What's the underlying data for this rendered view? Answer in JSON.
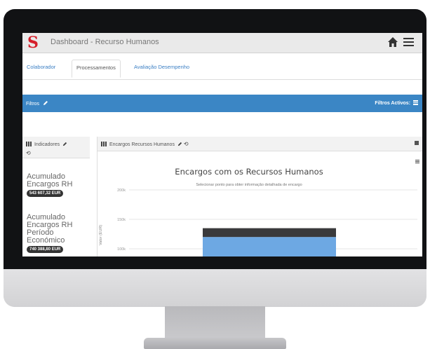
{
  "app": {
    "logo": "S",
    "title": "Dashboard - Recurso Humanos"
  },
  "tabs": [
    {
      "label": "Colaborador"
    },
    {
      "label": "Processamentos",
      "active": true
    },
    {
      "label": "Avaliação Desempenho"
    }
  ],
  "filters": {
    "label": "Filtros",
    "active_label": "Filtros Activos:"
  },
  "indicators": {
    "title": "Indicadores",
    "items": [
      {
        "label": "Acumulado Encargos RH",
        "value": "543 607,32 EUR"
      },
      {
        "label": "Acumulado Encargos RH Período Económico",
        "value": "740 388,80 EUR"
      }
    ]
  },
  "panel": {
    "title": "Encargos Recursos Humanos"
  },
  "chart_data": {
    "type": "bar",
    "title": "Encargos com os Recursos Humanos",
    "subtitle": "Selecionar ponto para obter informação detalhada de encargo",
    "ylabel": "Valor (EUR)",
    "y_ticks": [
      "200k",
      "150k",
      "100k"
    ],
    "ylim": [
      0,
      200000
    ],
    "series": [
      {
        "color": "#f0f0f0",
        "values": [
          135000
        ]
      },
      {
        "color": "#3a3a3c",
        "values": [
          15000
        ]
      },
      {
        "color": "#6da8e3",
        "values": [
          120000
        ]
      }
    ]
  },
  "colors": {
    "accent": "#3b86c5",
    "logo": "#d61f2b",
    "link": "#3b7fc4"
  },
  "icons": {
    "home": "home-icon",
    "menu": "hamburger-menu-icon",
    "edit": "pencil-icon",
    "refresh": "refresh-icon",
    "bars": "bar-chart-icon"
  }
}
